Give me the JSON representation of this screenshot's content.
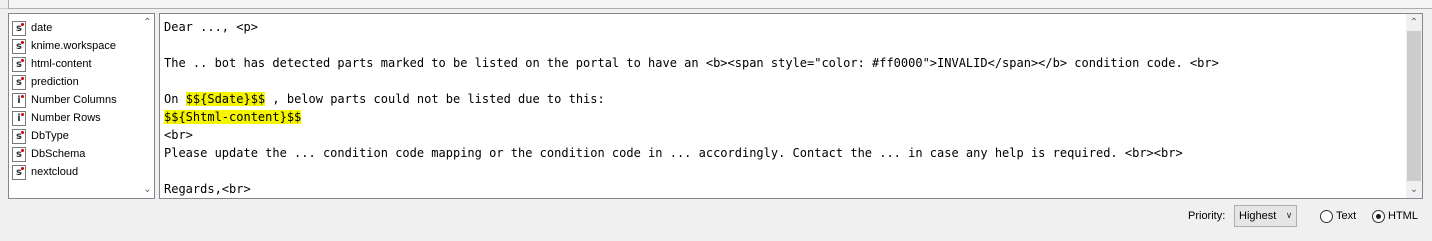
{
  "variables": [
    {
      "type": "s",
      "name": "date"
    },
    {
      "type": "s",
      "name": "knime.workspace"
    },
    {
      "type": "s",
      "name": "html-content"
    },
    {
      "type": "s",
      "name": "prediction"
    },
    {
      "type": "i",
      "name": "Number Columns"
    },
    {
      "type": "i",
      "name": "Number Rows"
    },
    {
      "type": "s",
      "name": "DbType"
    },
    {
      "type": "s",
      "name": "DbSchema"
    },
    {
      "type": "s",
      "name": "nextcloud"
    }
  ],
  "editor": {
    "line1": "Dear ..., <p>",
    "line2": "",
    "line3": "The .. bot has detected parts marked to be listed on the portal to have an <b><span style=\"color: #ff0000\">INVALID</span></b> condition code. <br>",
    "line4": "",
    "line5_pre": "On ",
    "line5_hl": "$${Sdate}$$",
    "line5_post": " , below parts could not be listed due to this:",
    "line6_hl": "$${Shtml-content}$$",
    "line7": "<br>",
    "line8": "Please update the ... condition code mapping or the condition code in ... accordingly. Contact the ... in case any help is required. <br><br>",
    "line9": "",
    "line10": "Regards,<br>"
  },
  "controls": {
    "priority_label": "Priority:",
    "priority_value": "Highest",
    "radio_text": "Text",
    "radio_html": "HTML",
    "selected_format": "HTML"
  },
  "colors": {
    "highlight": "#f5f500"
  }
}
